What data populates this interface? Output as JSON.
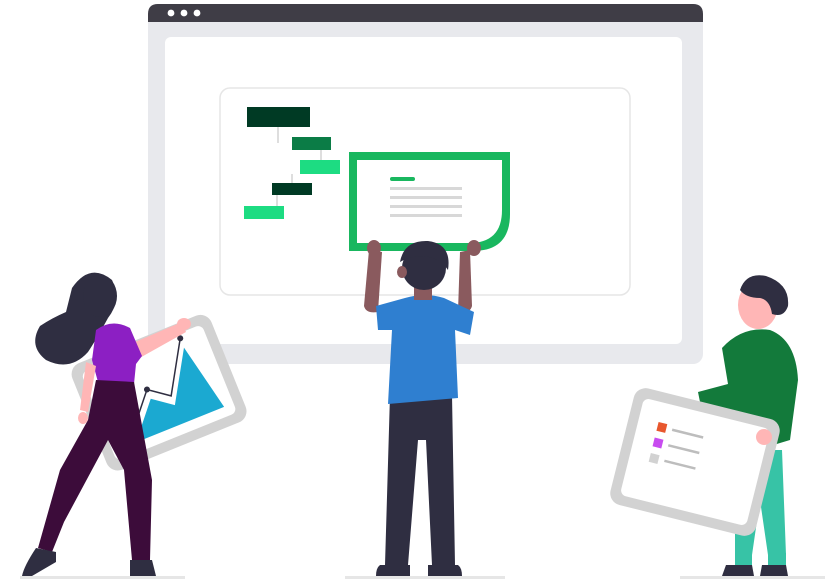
{
  "illustration": {
    "browser_dots": [
      "dot",
      "dot",
      "dot"
    ],
    "gantt_rows": [
      "task",
      "task",
      "task",
      "task",
      "task"
    ],
    "people": [
      "woman-with-chart",
      "man-holding-card",
      "man-with-list-card"
    ]
  },
  "colors": {
    "browser_bar": "#3f3d46",
    "browser_frame": "#e8e9ed",
    "panel": "#f2f2f2",
    "panel_border": "#e6e6e6",
    "gantt_dark": "#003a24",
    "gantt_mid": "#0b7c46",
    "gantt_light": "#1ddc82",
    "card_green": "#19b75f",
    "card_line": "#d8d8d8",
    "hair": "#2f2e41",
    "skin_dark": "#8a5a5e",
    "skin_light": "#ffb6b6",
    "shirt_purple": "#8c1fc3",
    "shirt_blue": "#2f7fd0",
    "shirt_green": "#137a3b",
    "pants_dark": "#2f2e41",
    "pants_plum": "#3c0c3a",
    "pants_teal": "#37c3a6",
    "chart_teal": "#1ba9d1",
    "board_gray": "#d2d2d2",
    "list_red": "#e8572e",
    "list_purple": "#c84cf0",
    "ground": "#e6e6e6"
  }
}
